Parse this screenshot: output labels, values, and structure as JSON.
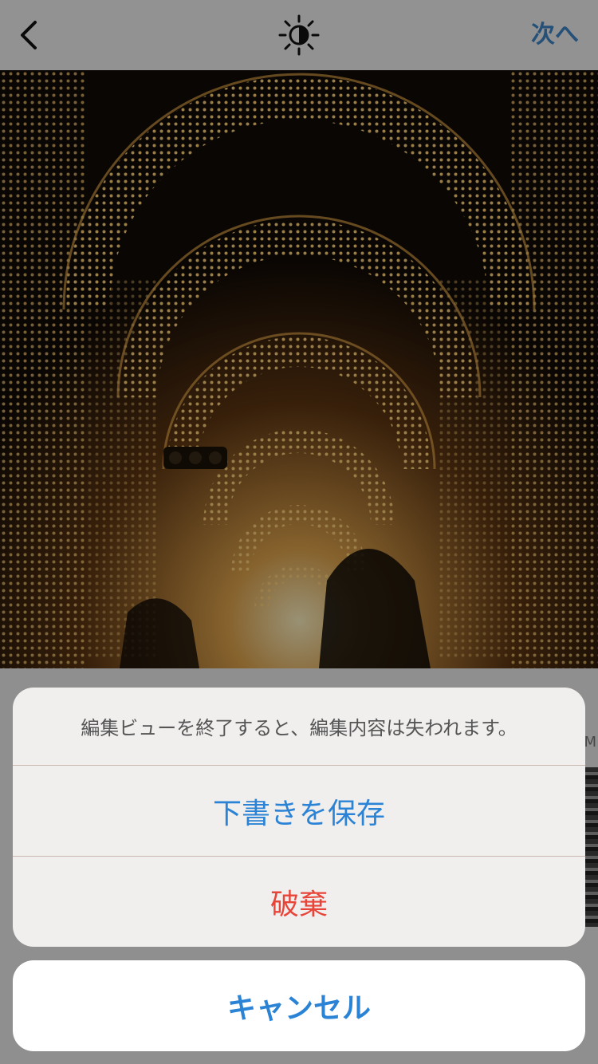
{
  "nav": {
    "back_icon": "chevron-left-icon",
    "adjust_icon": "brightness-icon",
    "next_label": "次へ"
  },
  "background": {
    "partial_label": "M"
  },
  "action_sheet": {
    "message": "編集ビューを終了すると、編集内容は失われます。",
    "save_draft_label": "下書きを保存",
    "discard_label": "破棄",
    "cancel_label": "キャンセル"
  },
  "colors": {
    "accent_blue": "#2b83d6",
    "destructive_red": "#e8453a",
    "nav_blue": "#3f86c9"
  }
}
